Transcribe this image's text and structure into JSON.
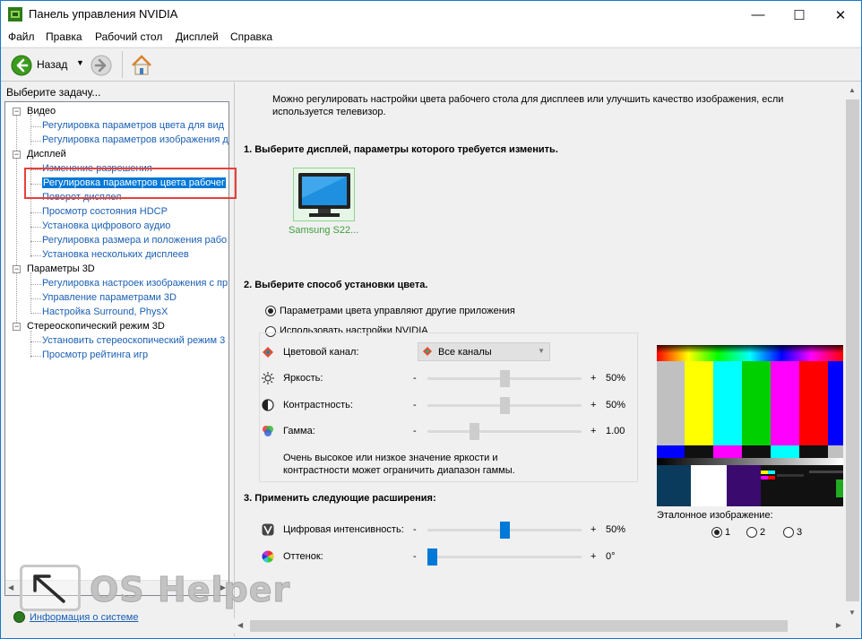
{
  "window": {
    "title": "Панель управления NVIDIA",
    "minimize": "—",
    "maximize": "☐",
    "close": "✕"
  },
  "menu": [
    "Файл",
    "Правка",
    "Рабочий стол",
    "Дисплей",
    "Справка"
  ],
  "toolbar": {
    "back_label": "Назад",
    "icons": [
      "back-arrow-icon",
      "dropdown-arrow-icon",
      "forward-arrow-icon",
      "home-icon"
    ]
  },
  "left": {
    "task_label": "Выберите задачу...",
    "tree": {
      "video": "Видео",
      "video_items": [
        "Регулировка параметров цвета для вид",
        "Регулировка параметров изображения д"
      ],
      "display": "Дисплей",
      "display_items": [
        "Изменение разрешения",
        "Регулировка параметров цвета рабочег",
        "Поворот дисплея",
        "Просмотр состояния HDCP",
        "Установка цифрового аудио",
        "Регулировка размера и положения рабо",
        "Установка нескольких дисплеев"
      ],
      "p3d": "Параметры 3D",
      "p3d_items": [
        "Регулировка настроек изображения с пр",
        "Управление параметрами 3D",
        "Настройка Surround, PhysX"
      ],
      "stereo": "Стереоскопический режим 3D",
      "stereo_items": [
        "Установить стереоскопический режим 3",
        "Просмотр рейтинга игр"
      ]
    },
    "system_info": "Информация о системе"
  },
  "right": {
    "description": "Можно регулировать настройки цвета рабочего стола для дисплеев или улучшить качество изображения, если используется телевизор.",
    "step1": "1. Выберите дисплей, параметры которого требуется изменить.",
    "monitor_label": "Samsung S22...",
    "step2": "2. Выберите способ установки цвета.",
    "radio_other": "Параметрами цвета управляют другие приложения",
    "radio_nvidia": "Использовать настройки NVIDIA",
    "channel_label": "Цветовой канал:",
    "channel_value": "Все каналы",
    "brightness_label": "Яркость:",
    "brightness_value": "50%",
    "contrast_label": "Контрастность:",
    "contrast_value": "50%",
    "gamma_label": "Гамма:",
    "gamma_value": "1.00",
    "minus": "-",
    "plus": "+",
    "note": "Очень высокое или низкое значение яркости и контрастности может ограничить диапазон гаммы.",
    "step3": "3. Применить следующие расширения:",
    "vibrance_label": "Цифровая интенсивность:",
    "vibrance_value": "50%",
    "hue_label": "Оттенок:",
    "hue_value": "0°",
    "reference_label": "Эталонное изображение:",
    "ref_options": [
      "1",
      "2",
      "3"
    ]
  },
  "levels": {
    "brightness": 0.5,
    "contrast": 0.5,
    "gamma": 0.29,
    "vibrance": 0.5,
    "hue": 0.0
  },
  "watermark": "OS Helper",
  "colors": {
    "accent": "#0078d7",
    "highlight_frame": "#e8403a",
    "monitor_text": "#3d9e3d"
  }
}
